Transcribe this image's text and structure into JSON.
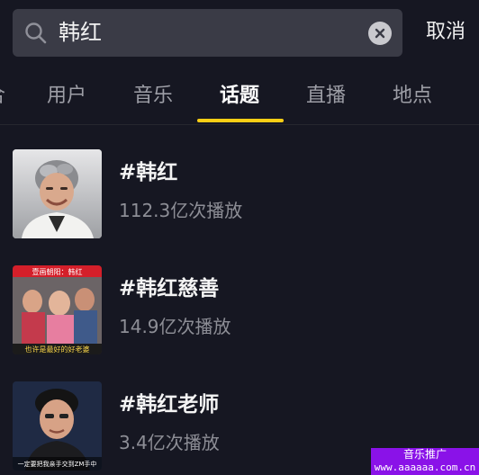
{
  "search": {
    "query": "韩红",
    "cancel_label": "取消"
  },
  "tabs": [
    {
      "label": "用户",
      "active": false
    },
    {
      "label": "音乐",
      "active": false
    },
    {
      "label": "话题",
      "active": true
    },
    {
      "label": "直播",
      "active": false
    },
    {
      "label": "地点",
      "active": false
    }
  ],
  "topics": [
    {
      "title": "#韩红",
      "plays": "112.3亿次播放"
    },
    {
      "title": "#韩红慈善",
      "plays": "14.9亿次播放",
      "thumb_top_text": "壹画朝阳：韩红",
      "thumb_bottom_text": "也许是最好的好老婆"
    },
    {
      "title": "#韩红老师",
      "plays": "3.4亿次播放",
      "thumb_caption": "一定要把我亲手交到ZM手中"
    }
  ],
  "watermark": {
    "title": "音乐推广",
    "url": "www.aaaaaa.com.cn"
  },
  "colors": {
    "background": "#161722",
    "search_box": "#3a3b46",
    "accent_indicator": "#face15",
    "watermark": "#8a12e8"
  }
}
